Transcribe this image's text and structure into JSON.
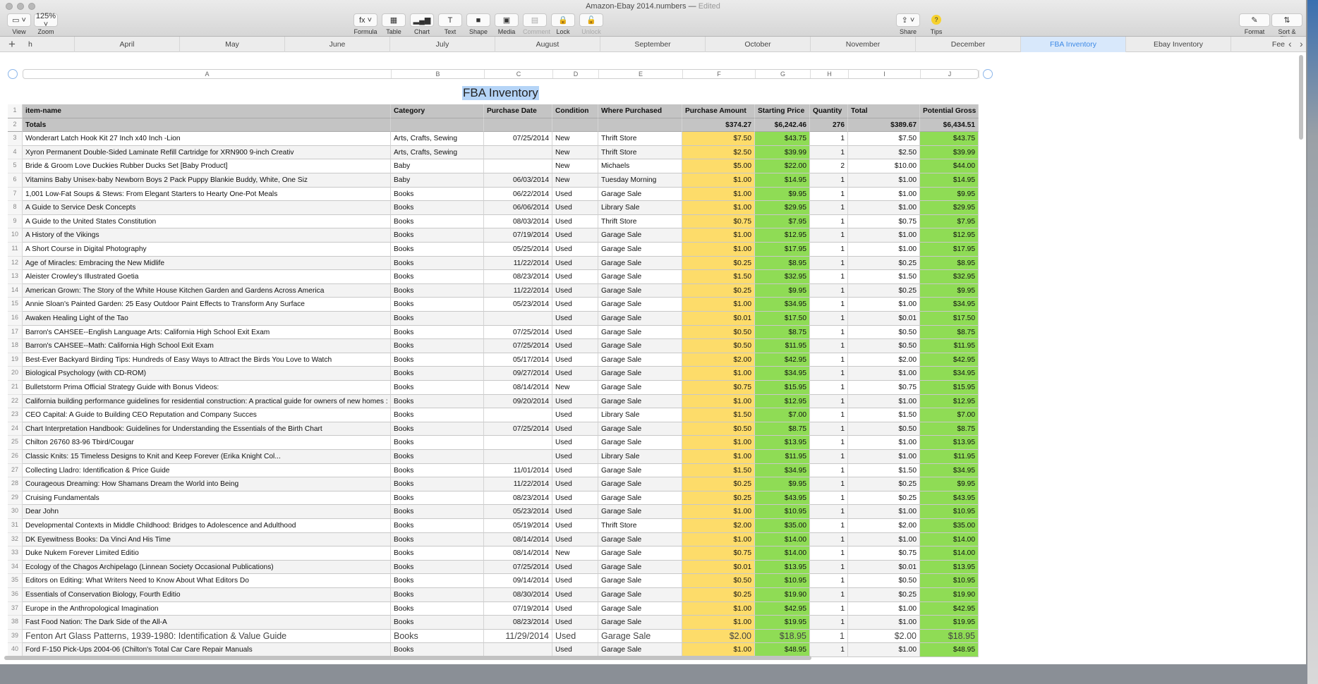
{
  "window": {
    "title": "Amazon-Ebay 2014.numbers",
    "status": "Edited"
  },
  "toolbar": {
    "left": [
      {
        "label": "View",
        "icon": "view-icon",
        "glyph": "▭ ˅"
      },
      {
        "label": "Zoom",
        "icon": "zoom-select",
        "glyph": "125% ˅"
      }
    ],
    "center": [
      {
        "label": "Formula",
        "icon": "formula-icon",
        "glyph": "fx ˅"
      },
      {
        "label": "Table",
        "icon": "table-icon",
        "glyph": "▦"
      },
      {
        "label": "Chart",
        "icon": "chart-icon",
        "glyph": "▂▄▆"
      },
      {
        "label": "Text",
        "icon": "text-icon",
        "glyph": "T"
      },
      {
        "label": "Shape",
        "icon": "shape-icon",
        "glyph": "■"
      },
      {
        "label": "Media",
        "icon": "media-icon",
        "glyph": "▣"
      },
      {
        "label": "Comment",
        "icon": "comment-icon",
        "glyph": "▤",
        "disabled": true
      },
      {
        "label": "Lock",
        "icon": "lock-icon",
        "glyph": "🔒"
      },
      {
        "label": "Unlock",
        "icon": "unlock-icon",
        "glyph": "🔓",
        "disabled": true
      }
    ],
    "right1": [
      {
        "label": "Share",
        "icon": "share-icon",
        "glyph": "⇪ ˅"
      },
      {
        "label": "Tips",
        "icon": "tips-icon",
        "glyph": "?"
      }
    ],
    "right2": [
      {
        "label": "Format",
        "icon": "format-icon",
        "glyph": "✎"
      },
      {
        "label": "Sort & Filter",
        "icon": "sort-filter-icon",
        "glyph": "⇅"
      }
    ]
  },
  "sheets": [
    "h",
    "April",
    "May",
    "June",
    "July",
    "August",
    "September",
    "October",
    "November",
    "December",
    "FBA Inventory",
    "Ebay Inventory",
    "Fee"
  ],
  "active_sheet": "FBA Inventory",
  "column_letters": [
    "A",
    "B",
    "C",
    "D",
    "E",
    "F",
    "G",
    "H",
    "I",
    "J"
  ],
  "table": {
    "title": "FBA Inventory",
    "headers": [
      "item-name",
      "Category",
      "Purchase Date",
      "Condition",
      "Where Purchased",
      "Purchase Amount",
      "Starting Price",
      "Quantity",
      "Total",
      "Potential Gross"
    ],
    "totals": [
      "Totals",
      "",
      "",
      "",
      "",
      "$374.27",
      "$6,242.46",
      "276",
      "$389.67",
      "$6,434.51"
    ],
    "rows": [
      [
        "Wonderart Latch Hook Kit 27 Inch x40 Inch -Lion",
        "Arts, Crafts, Sewing",
        "07/25/2014",
        "New",
        "Thrift Store",
        "$7.50",
        "$43.75",
        "1",
        "$7.50",
        "$43.75"
      ],
      [
        "Xyron Permanent Double-Sided Laminate Refill Cartridge for XRN900 9-inch Creativ",
        "Arts, Crafts, Sewing",
        "",
        "New",
        "Thrift Store",
        "$2.50",
        "$39.99",
        "1",
        "$2.50",
        "$39.99"
      ],
      [
        "Bride & Groom Love Duckies Rubber Ducks Set [Baby Product]",
        "Baby",
        "",
        "New",
        "Michaels",
        "$5.00",
        "$22.00",
        "2",
        "$10.00",
        "$44.00"
      ],
      [
        "Vitamins Baby Unisex-baby Newborn Boys 2 Pack Puppy Blankie Buddy, White, One Siz",
        "Baby",
        "06/03/2014",
        "New",
        "Tuesday Morning",
        "$1.00",
        "$14.95",
        "1",
        "$1.00",
        "$14.95"
      ],
      [
        "1,001 Low-Fat Soups & Stews: From Elegant Starters to Hearty One-Pot Meals",
        "Books",
        "06/22/2014",
        "Used",
        "Garage Sale",
        "$1.00",
        "$9.95",
        "1",
        "$1.00",
        "$9.95"
      ],
      [
        "A Guide to Service Desk Concepts",
        "Books",
        "06/06/2014",
        "Used",
        "Library Sale",
        "$1.00",
        "$29.95",
        "1",
        "$1.00",
        "$29.95"
      ],
      [
        "A Guide to the United States Constitution",
        "Books",
        "08/03/2014",
        "Used",
        "Thrift Store",
        "$0.75",
        "$7.95",
        "1",
        "$0.75",
        "$7.95"
      ],
      [
        "A History of the Vikings",
        "Books",
        "07/19/2014",
        "Used",
        "Garage Sale",
        "$1.00",
        "$12.95",
        "1",
        "$1.00",
        "$12.95"
      ],
      [
        "A Short Course in Digital Photography",
        "Books",
        "05/25/2014",
        "Used",
        "Garage Sale",
        "$1.00",
        "$17.95",
        "1",
        "$1.00",
        "$17.95"
      ],
      [
        "Age of Miracles: Embracing the New Midlife",
        "Books",
        "11/22/2014",
        "Used",
        "Garage Sale",
        "$0.25",
        "$8.95",
        "1",
        "$0.25",
        "$8.95"
      ],
      [
        "Aleister Crowley's Illustrated Goetia",
        "Books",
        "08/23/2014",
        "Used",
        "Garage Sale",
        "$1.50",
        "$32.95",
        "1",
        "$1.50",
        "$32.95"
      ],
      [
        "American Grown: The Story of the White House Kitchen Garden and Gardens Across America",
        "Books",
        "11/22/2014",
        "Used",
        "Garage Sale",
        "$0.25",
        "$9.95",
        "1",
        "$0.25",
        "$9.95"
      ],
      [
        "Annie Sloan's Painted Garden: 25 Easy Outdoor Paint Effects to Transform Any Surface",
        "Books",
        "05/23/2014",
        "Used",
        "Garage Sale",
        "$1.00",
        "$34.95",
        "1",
        "$1.00",
        "$34.95"
      ],
      [
        "Awaken Healing Light of the Tao",
        "Books",
        "",
        "Used",
        "Garage Sale",
        "$0.01",
        "$17.50",
        "1",
        "$0.01",
        "$17.50"
      ],
      [
        "Barron's CAHSEE--English Language Arts: California High School Exit Exam",
        "Books",
        "07/25/2014",
        "Used",
        "Garage Sale",
        "$0.50",
        "$8.75",
        "1",
        "$0.50",
        "$8.75"
      ],
      [
        "Barron's CAHSEE--Math: California High School Exit Exam",
        "Books",
        "07/25/2014",
        "Used",
        "Garage Sale",
        "$0.50",
        "$11.95",
        "1",
        "$0.50",
        "$11.95"
      ],
      [
        "Best-Ever Backyard Birding Tips: Hundreds of Easy Ways to Attract the Birds You Love to Watch",
        "Books",
        "05/17/2014",
        "Used",
        "Garage Sale",
        "$2.00",
        "$42.95",
        "1",
        "$2.00",
        "$42.95"
      ],
      [
        "Biological Psychology (with CD-ROM)",
        "Books",
        "09/27/2014",
        "Used",
        "Garage Sale",
        "$1.00",
        "$34.95",
        "1",
        "$1.00",
        "$34.95"
      ],
      [
        "Bulletstorm Prima Official Strategy Guide with Bonus Videos:",
        "Books",
        "08/14/2014",
        "New",
        "Garage Sale",
        "$0.75",
        "$15.95",
        "1",
        "$0.75",
        "$15.95"
      ],
      [
        "California building performance guidelines for residential construction: A practical guide for owners of new homes : constr",
        "Books",
        "09/20/2014",
        "Used",
        "Garage Sale",
        "$1.00",
        "$12.95",
        "1",
        "$1.00",
        "$12.95"
      ],
      [
        "CEO Capital: A Guide to Building CEO Reputation and Company Succes",
        "Books",
        "",
        "Used",
        "Library Sale",
        "$1.50",
        "$7.00",
        "1",
        "$1.50",
        "$7.00"
      ],
      [
        "Chart Interpretation Handbook: Guidelines for Understanding the Essentials of the Birth Chart",
        "Books",
        "07/25/2014",
        "Used",
        "Garage Sale",
        "$0.50",
        "$8.75",
        "1",
        "$0.50",
        "$8.75"
      ],
      [
        "Chilton 26760 83-96 Tbird/Cougar",
        "Books",
        "",
        "Used",
        "Garage Sale",
        "$1.00",
        "$13.95",
        "1",
        "$1.00",
        "$13.95"
      ],
      [
        "Classic Knits: 15 Timeless Designs to Knit and Keep Forever (Erika Knight Col...",
        "Books",
        "",
        "Used",
        "Library Sale",
        "$1.00",
        "$11.95",
        "1",
        "$1.00",
        "$11.95"
      ],
      [
        "Collecting Lladro: Identification & Price Guide",
        "Books",
        "11/01/2014",
        "Used",
        "Garage Sale",
        "$1.50",
        "$34.95",
        "1",
        "$1.50",
        "$34.95"
      ],
      [
        "Courageous Dreaming: How Shamans Dream the World into Being",
        "Books",
        "11/22/2014",
        "Used",
        "Garage Sale",
        "$0.25",
        "$9.95",
        "1",
        "$0.25",
        "$9.95"
      ],
      [
        "Cruising Fundamentals",
        "Books",
        "08/23/2014",
        "Used",
        "Garage Sale",
        "$0.25",
        "$43.95",
        "1",
        "$0.25",
        "$43.95"
      ],
      [
        "Dear John",
        "Books",
        "05/23/2014",
        "Used",
        "Garage Sale",
        "$1.00",
        "$10.95",
        "1",
        "$1.00",
        "$10.95"
      ],
      [
        "Developmental Contexts in Middle Childhood: Bridges to Adolescence and Adulthood",
        "Books",
        "05/19/2014",
        "Used",
        "Thrift Store",
        "$2.00",
        "$35.00",
        "1",
        "$2.00",
        "$35.00"
      ],
      [
        "DK Eyewitness Books: Da Vinci And His Time",
        "Books",
        "08/14/2014",
        "Used",
        "Garage Sale",
        "$1.00",
        "$14.00",
        "1",
        "$1.00",
        "$14.00"
      ],
      [
        "Duke Nukem Forever Limited Editio",
        "Books",
        "08/14/2014",
        "New",
        "Garage Sale",
        "$0.75",
        "$14.00",
        "1",
        "$0.75",
        "$14.00"
      ],
      [
        "Ecology of the Chagos Archipelago (Linnean Society Occasional Publications)",
        "Books",
        "07/25/2014",
        "Used",
        "Garage Sale",
        "$0.01",
        "$13.95",
        "1",
        "$0.01",
        "$13.95"
      ],
      [
        "Editors on Editing: What Writers Need to Know About What Editors Do",
        "Books",
        "09/14/2014",
        "Used",
        "Garage Sale",
        "$0.50",
        "$10.95",
        "1",
        "$0.50",
        "$10.95"
      ],
      [
        "Essentials of Conservation Biology, Fourth Editio",
        "Books",
        "08/30/2014",
        "Used",
        "Garage Sale",
        "$0.25",
        "$19.90",
        "1",
        "$0.25",
        "$19.90"
      ],
      [
        "Europe in the Anthropological Imagination",
        "Books",
        "07/19/2014",
        "Used",
        "Garage Sale",
        "$1.00",
        "$42.95",
        "1",
        "$1.00",
        "$42.95"
      ],
      [
        "Fast Food Nation: The Dark Side of the All-A",
        "Books",
        "08/23/2014",
        "Used",
        "Garage Sale",
        "$1.00",
        "$19.95",
        "1",
        "$1.00",
        "$19.95"
      ],
      [
        "Fenton Art Glass Patterns, 1939-1980: Identification & Value Guide",
        "Books",
        "11/29/2014",
        "Used",
        "Garage Sale",
        "$2.00",
        "$18.95",
        "1",
        "$2.00",
        "$18.95"
      ],
      [
        "Ford F-150 Pick-Ups 2004-06 (Chilton's Total Car Care Repair Manuals",
        "Books",
        "",
        "Used",
        "Garage Sale",
        "$1.00",
        "$48.95",
        "1",
        "$1.00",
        "$48.95"
      ]
    ]
  },
  "colors": {
    "purchase_amount": "#fddc6a",
    "price_gross": "#8fdc55",
    "header": "#c4c4c4",
    "selected_tab": "#3e8ae6"
  }
}
